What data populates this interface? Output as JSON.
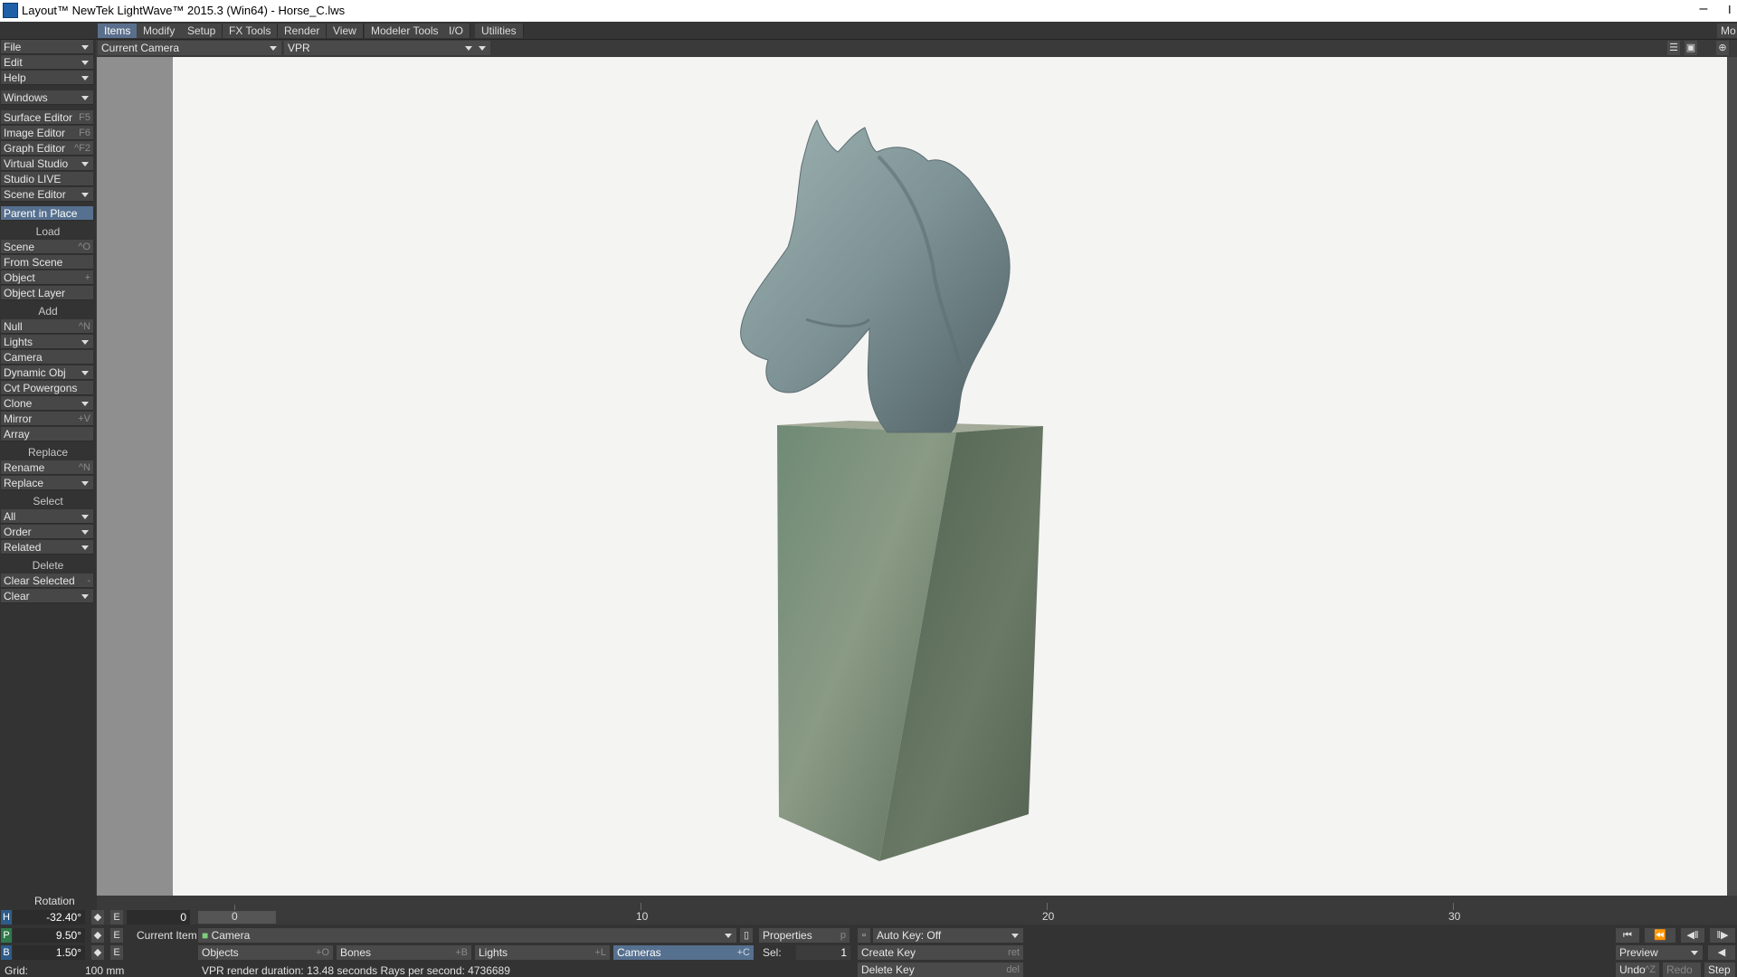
{
  "window": {
    "title": "Layout™ NewTek LightWave™ 2015.3 (Win64) - Horse_C.lws",
    "minimize_glyph": "–",
    "right_glyph": "I"
  },
  "tabs": [
    "Items",
    "Modify",
    "Setup",
    "FX Tools",
    "Render",
    "View",
    "Modeler Tools",
    "I/O",
    "Utilities"
  ],
  "modeler_button": "Mo",
  "left_menu": {
    "file": "File",
    "edit": "Edit",
    "help": "Help",
    "windows": "Windows",
    "surface_editor": "Surface Editor",
    "surface_editor_sc": "F5",
    "image_editor": "Image Editor",
    "image_editor_sc": "F6",
    "graph_editor": "Graph Editor",
    "graph_editor_sc": "^F2",
    "virtual_studio": "Virtual Studio",
    "studio_live": "Studio LIVE",
    "scene_editor": "Scene Editor",
    "parent_in_place": "Parent in Place",
    "load_header": "Load",
    "scene": "Scene",
    "scene_sc": "^O",
    "from_scene": "From Scene",
    "object": "Object",
    "object_sc": "+",
    "object_layer": "Object Layer",
    "add_header": "Add",
    "null": "Null",
    "null_sc": "^N",
    "lights": "Lights",
    "camera": "Camera",
    "dynamic_obj": "Dynamic Obj",
    "cvt_powergons": "Cvt Powergons",
    "clone": "Clone",
    "mirror": "Mirror",
    "mirror_sc": "+V",
    "array": "Array",
    "replace_header": "Replace",
    "rename": "Rename",
    "rename_sc": "^N",
    "replace": "Replace",
    "select_header": "Select",
    "all": "All",
    "order": "Order",
    "related": "Related",
    "delete_header": "Delete",
    "clear_selected": "Clear Selected",
    "clear_selected_sc": "-",
    "clear": "Clear"
  },
  "viewport": {
    "camera_select": "Current Camera",
    "render_mode": "VPR"
  },
  "timeline": {
    "current_frame": "0",
    "tick_labels": [
      "10",
      "20",
      "30"
    ]
  },
  "transform": {
    "label": "Rotation",
    "h_axis": "H",
    "h_value": "-32.40°",
    "p_axis": "P",
    "p_value": "9.50°",
    "b_axis": "B",
    "b_value": "1.50°",
    "e_label": "E",
    "frame_value": "0"
  },
  "current_item": {
    "label": "Current Item",
    "value": "Camera"
  },
  "item_types": {
    "objects": "Objects",
    "objects_sc": "+O",
    "bones": "Bones",
    "bones_sc": "+B",
    "lights": "Lights",
    "lights_sc": "+L",
    "cameras": "Cameras",
    "cameras_sc": "+C"
  },
  "properties": {
    "label": "Properties",
    "sc": "p"
  },
  "sel": {
    "label": "Sel:",
    "value": "1"
  },
  "auto_key": "Auto Key: Off",
  "create_key": {
    "label": "Create Key",
    "sc": "ret"
  },
  "delete_key": {
    "label": "Delete Key",
    "sc": "del"
  },
  "preview": "Preview",
  "undo": "Undo",
  "undo_sc": "^Z",
  "redo": "Redo",
  "step": "Step",
  "grid": {
    "label": "Grid:",
    "value": "100 mm"
  },
  "status": "VPR render duration: 13.48 seconds  Rays per second: 4736689",
  "colors": {
    "accent": "#56708f",
    "viewport_bg": "#f4f4f3",
    "panel": "#333333"
  }
}
